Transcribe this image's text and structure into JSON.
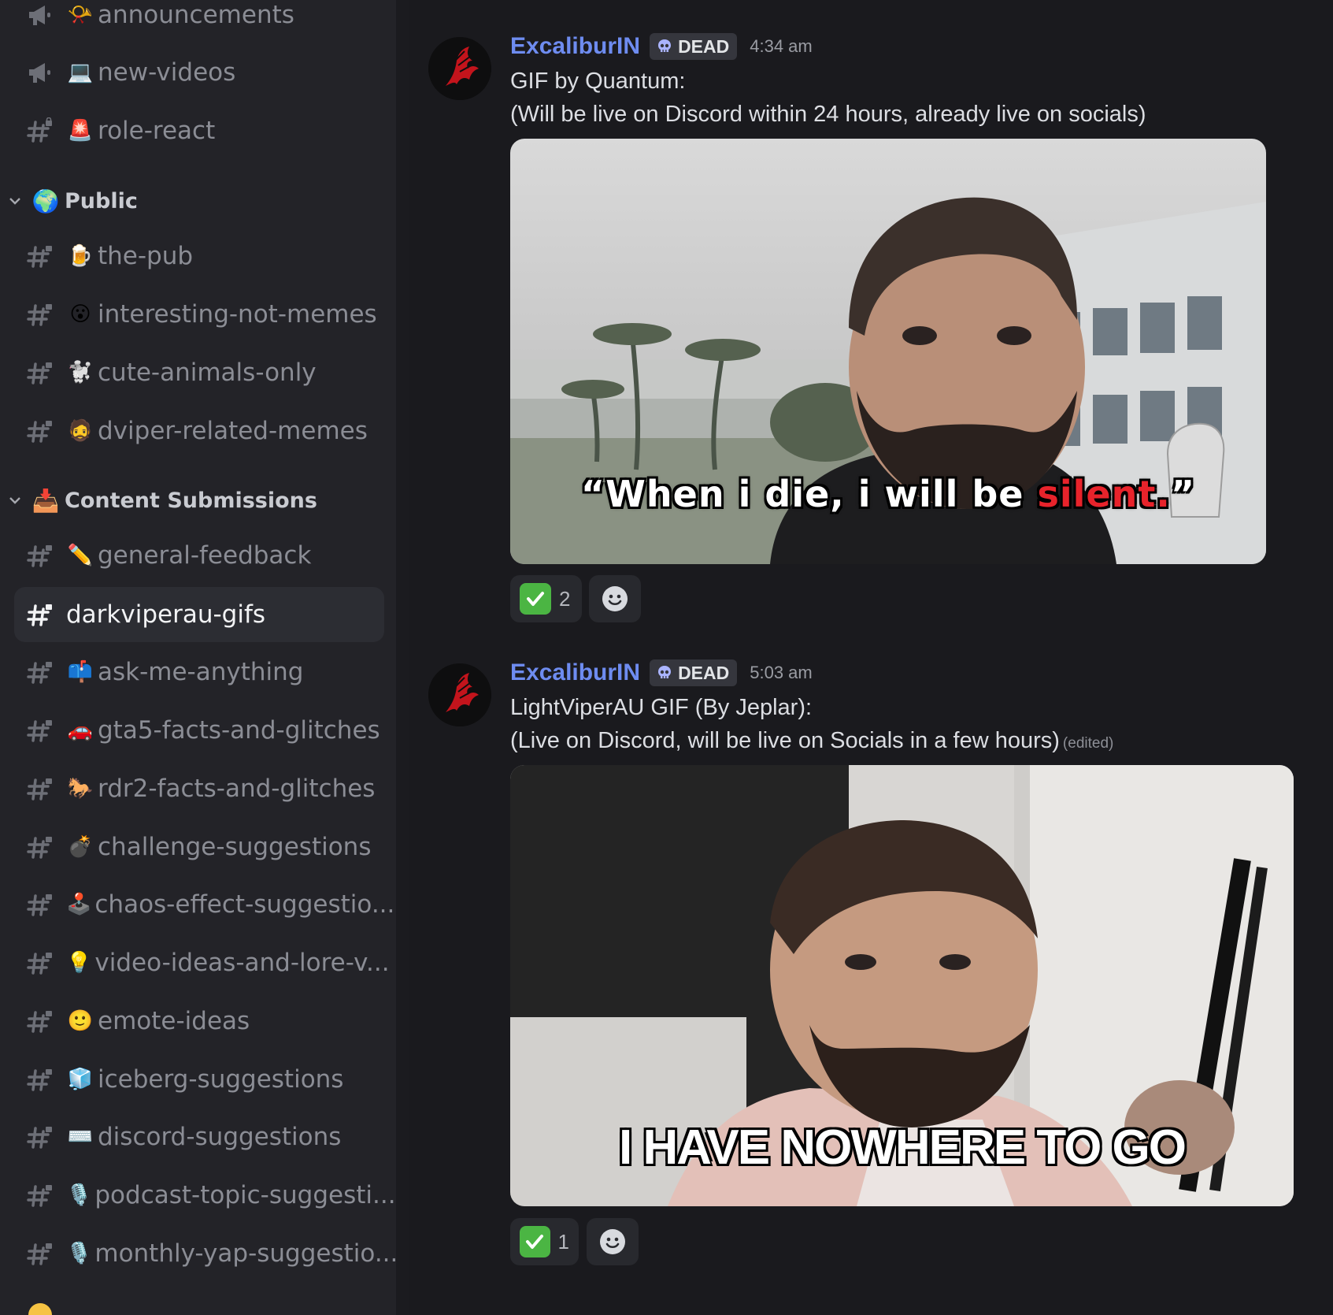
{
  "sidebar": {
    "channels_top": [
      {
        "label": "announcements",
        "icon": "megaphone-icon",
        "emoji": "📯"
      },
      {
        "label": "new-videos",
        "icon": "megaphone-icon",
        "emoji": "💻"
      },
      {
        "label": "role-react",
        "icon": "hash-icon",
        "emoji": "🚨"
      }
    ],
    "categories": [
      {
        "label": "Public",
        "emoji": "🌍"
      },
      {
        "label": "Content Submissions",
        "emoji": "📥"
      }
    ],
    "public_channels": [
      {
        "label": "the-pub",
        "emoji": "🍺"
      },
      {
        "label": "interesting-not-memes",
        "emoji": "😮"
      },
      {
        "label": "cute-animals-only",
        "emoji": "🐩"
      },
      {
        "label": "dviper-related-memes",
        "emoji": "🧔"
      }
    ],
    "submission_channels": [
      {
        "label": "general-feedback",
        "emoji": "✏️"
      },
      {
        "label": "darkviperau-gifs",
        "emoji": "",
        "selected": true
      },
      {
        "label": "ask-me-anything",
        "emoji": "📫"
      },
      {
        "label": "gta5-facts-and-glitches",
        "emoji": "🚗"
      },
      {
        "label": "rdr2-facts-and-glitches",
        "emoji": "🐎"
      },
      {
        "label": "challenge-suggestions",
        "emoji": "💣"
      },
      {
        "label": "chaos-effect-suggestio...",
        "emoji": "🕹️"
      },
      {
        "label": "video-ideas-and-lore-v...",
        "emoji": "💡"
      },
      {
        "label": "emote-ideas",
        "emoji": "🙂"
      },
      {
        "label": "iceberg-suggestions",
        "emoji": "🧊"
      },
      {
        "label": "discord-suggestions",
        "emoji": "⌨️"
      },
      {
        "label": "podcast-topic-suggesti...",
        "emoji": "🎙️"
      },
      {
        "label": "monthly-yap-suggestio...",
        "emoji": "🎙️"
      }
    ]
  },
  "messages": [
    {
      "author": "ExcaliburIN",
      "badge": "DEAD",
      "time": "4:34 am",
      "line1": "GIF by Quantum:",
      "line2": "(Will be live on Discord within 24 hours, already live on socials)",
      "caption_pre": "“When i die, i will be ",
      "caption_red": "silent.",
      "caption_post": "”",
      "reaction_count": "2"
    },
    {
      "author": "ExcaliburIN",
      "badge": "DEAD",
      "time": "5:03 am",
      "line1": "LightViperAU GIF (By Jeplar):",
      "line2": "(Live on Discord, will be live on Socials in a few hours)",
      "edited": "(edited)",
      "caption": "I HAVE NOWHERE TO GO",
      "reaction_count": "1"
    }
  ],
  "colors": {
    "sidebar_bg": "#232328",
    "chat_bg": "#1a1a1e",
    "author": "#6e8cf0",
    "caption_red": "#e8232b",
    "check_green": "#4bb543"
  }
}
